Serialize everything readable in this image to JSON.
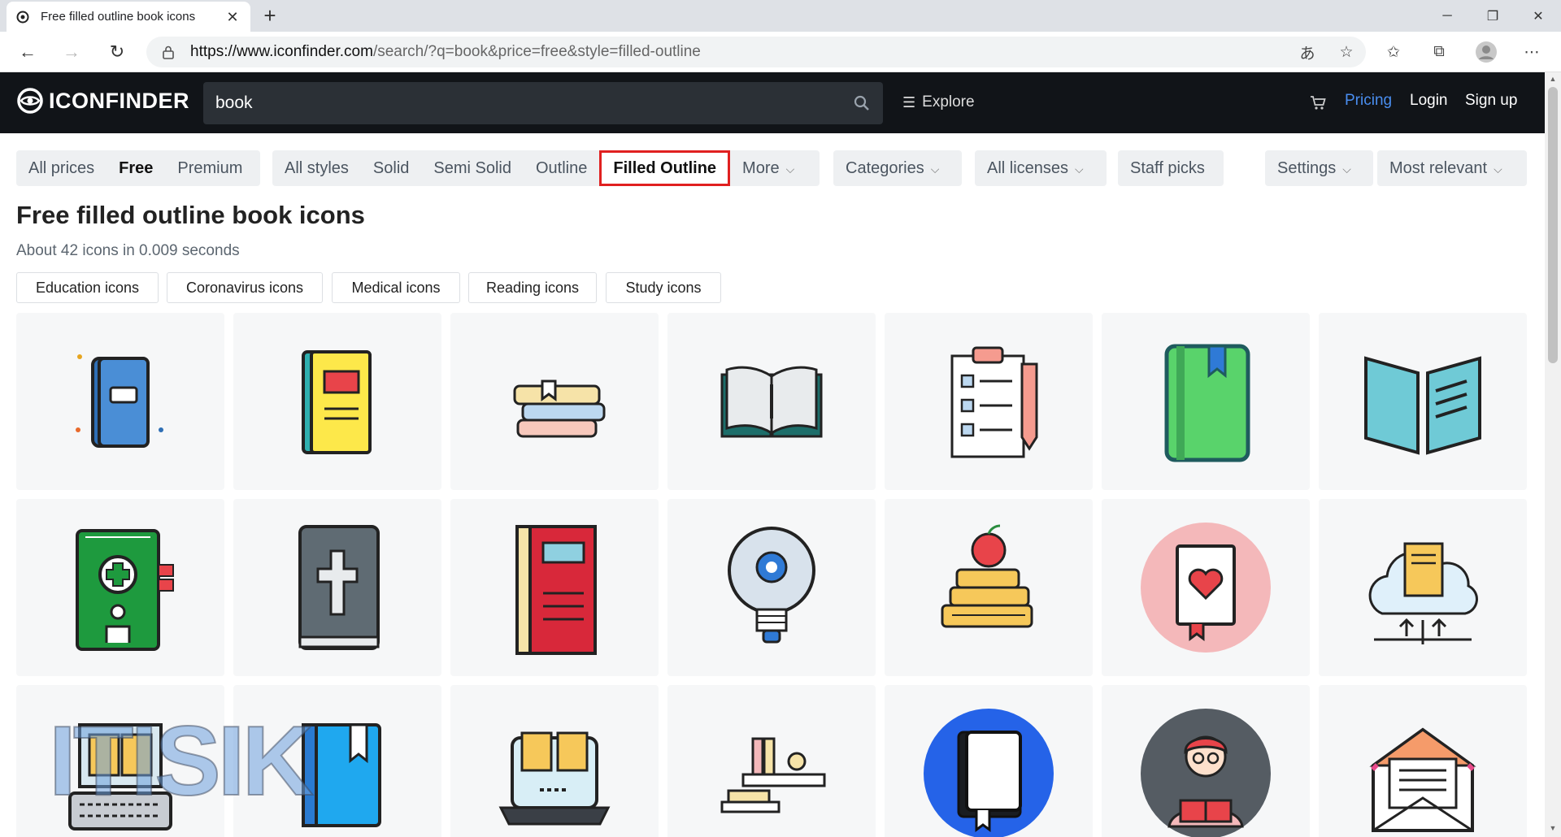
{
  "browser": {
    "tab_title": "Free filled outline book icons",
    "url_host": "https://www.iconfinder.com",
    "url_rest": "/search/?q=book&price=free&style=filled-outline"
  },
  "header": {
    "logo": "ICONFINDER",
    "search_value": "book",
    "explore": "Explore",
    "pricing": "Pricing",
    "login": "Login",
    "signup": "Sign up"
  },
  "filters": {
    "prices": [
      "All prices",
      "Free",
      "Premium"
    ],
    "styles": [
      "All styles",
      "Solid",
      "Semi Solid",
      "Outline",
      "Filled Outline",
      "More"
    ],
    "categories": "Categories",
    "licenses": "All licenses",
    "staff_picks": "Staff picks",
    "settings": "Settings",
    "sort": "Most relevant"
  },
  "page": {
    "title": "Free filled outline book icons",
    "result_info": "About 42 icons in 0.009 seconds"
  },
  "related_tags": [
    "Education icons",
    "Coronavirus icons",
    "Medical icons",
    "Reading icons",
    "Study icons"
  ],
  "icons": [
    "blue-book-icon",
    "yellow-book-icon",
    "stacked-books-icon",
    "open-book-icon",
    "checklist-pen-icon",
    "green-notebook-icon",
    "teal-open-book-icon",
    "medical-book-icon",
    "bible-icon",
    "red-book-icon",
    "idea-bulb-icon",
    "books-apple-icon",
    "favorite-book-icon",
    "cloud-book-icon",
    "ebook-laptop-icon",
    "blue-book-bookmark-icon",
    "online-reading-icon",
    "bookshelf-icon",
    "ebook-circle-icon",
    "reader-avatar-icon",
    "envelope-letter-icon"
  ],
  "watermark": "ITISIK",
  "colors": {
    "header_bg": "#111418",
    "accent": "#4a8ef0",
    "highlight_border": "#e02020"
  }
}
